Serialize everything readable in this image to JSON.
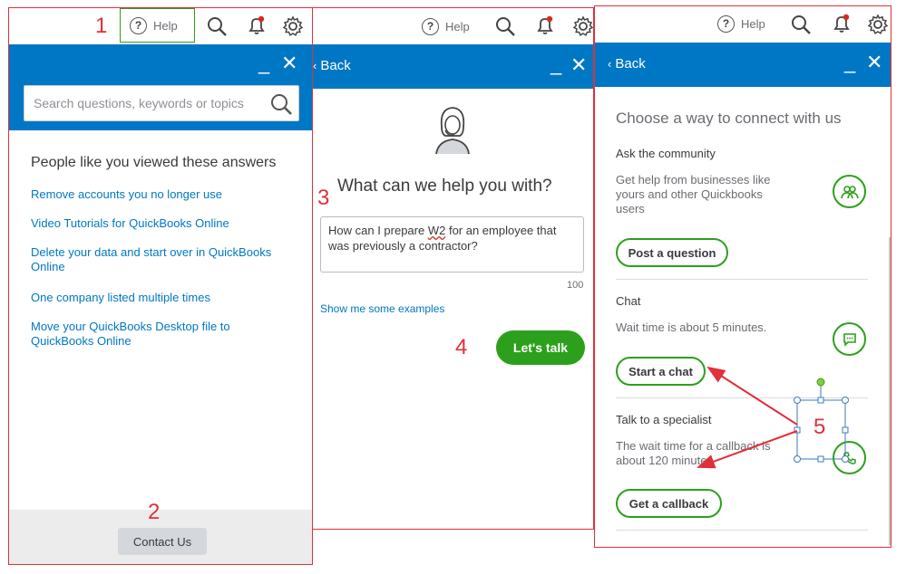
{
  "topbar": {
    "help_label": "Help"
  },
  "panel1": {
    "search_placeholder": "Search questions, keywords or topics",
    "heading": "People like you viewed these answers",
    "links": [
      "Remove accounts you no longer use",
      "Video Tutorials for QuickBooks Online",
      "Delete your data and start over in QuickBooks Online",
      "One company listed multiple times",
      "Move your QuickBooks Desktop file to QuickBooks Online"
    ],
    "contact_label": "Contact Us"
  },
  "panel2": {
    "back_label": "Back",
    "heading": "What can we help you with?",
    "question_pre": "How can I prepare ",
    "question_word": "W2",
    "question_post": " for an employee that was previously a contractor?",
    "char_count": "100",
    "examples_link": "Show me some examples",
    "talk_label": "Let's talk"
  },
  "panel3": {
    "back_label": "Back",
    "heading": "Choose a way to connect with us",
    "community_title": "Ask the community",
    "community_text": "Get help from businesses like yours and other Quickbooks users",
    "post_label": "Post a question",
    "chat_title": "Chat",
    "chat_text": "Wait time is about 5 minutes.",
    "chat_label": "Start a chat",
    "specialist_title": "Talk to a specialist",
    "specialist_text": "The wait time for a callback is about 120 minutes",
    "callback_label": "Get a callback"
  },
  "callouts": {
    "c1": "1",
    "c2": "2",
    "c3": "3",
    "c4": "4",
    "c5": "5"
  },
  "colors": {
    "brand_blue": "#0077c5",
    "brand_green": "#2ca01c",
    "annotation_red": "#e0303a"
  },
  "icons": [
    "help-icon",
    "search-icon",
    "bell-icon",
    "gear-icon",
    "minimize-icon",
    "close-icon",
    "chevron-left-icon",
    "agent-icon",
    "community-icon",
    "chat-icon",
    "phone-icon"
  ]
}
